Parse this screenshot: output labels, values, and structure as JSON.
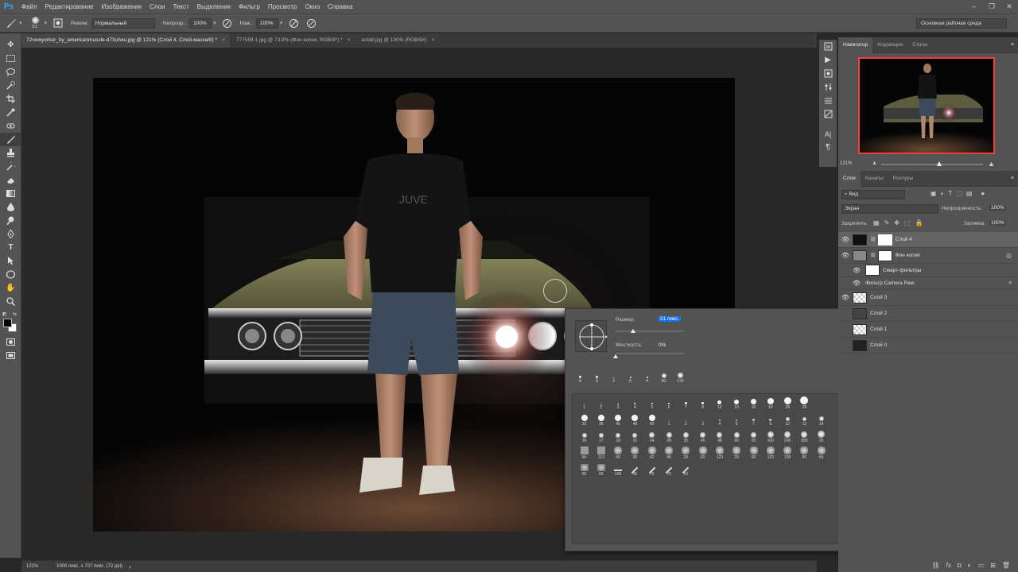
{
  "app": {
    "logo": "Ps"
  },
  "menu": [
    "Файл",
    "Редактирование",
    "Изображение",
    "Слои",
    "Текст",
    "Выделение",
    "Фильтр",
    "Просмотр",
    "Окно",
    "Справка"
  ],
  "window_controls": [
    "–",
    "❐",
    "✕"
  ],
  "options": {
    "brush_size": "51",
    "mode_label": "Режим:",
    "mode_value": "Нормальный",
    "opacity_label": "Непрозр.:",
    "opacity_value": "100%",
    "flow_label": "Наж.:",
    "flow_value": "100%",
    "workspace": "Основная рабочая среда"
  },
  "tabs": [
    {
      "label": "72newyorker_by_americanmuscle-d73uheu.jpg @ 121% (Слой 4, Слой-маска/8) *",
      "active": true
    },
    {
      "label": "777559-1.jpg @ 73,9% (Фон копия, RGB/8*) *",
      "active": false
    },
    {
      "label": "asfalt.jpg @ 100% (RGB/8#)",
      "active": false
    }
  ],
  "tab_close": "×",
  "status": {
    "zoom": "121%",
    "info": "1000 пикс. x 707 пикс. (72 ppi)",
    "arrow": "›"
  },
  "navigator": {
    "tabs": [
      "Навигатор",
      "Коррекция",
      "Стили"
    ],
    "zoom": "121%"
  },
  "layers_panel": {
    "tabs": [
      "Слои",
      "Каналы",
      "Контуры"
    ],
    "filter": "Вид",
    "blend_mode": "Экран",
    "opacity_label": "Непрозрачность:",
    "opacity_value": "100%",
    "lock_label": "Закрепить:",
    "fill_label": "Заливка:",
    "fill_value": "100%",
    "layers": [
      {
        "name": "Слой 4",
        "selected": true
      },
      {
        "name": "Фон копия",
        "selected": false
      },
      {
        "name": "Смарт-фильтры",
        "selected": false
      },
      {
        "name": "Фильтр Camera Raw",
        "selected": false
      },
      {
        "name": "Слой 3",
        "selected": false
      },
      {
        "name": "Слой 2",
        "selected": false
      },
      {
        "name": "Слой 1",
        "selected": false
      },
      {
        "name": "Слой 0",
        "selected": false
      }
    ]
  },
  "brush_picker": {
    "size_label": "Размер:",
    "size_value": "51 пикс.",
    "hardness_label": "Жесткость:",
    "hardness_value": "0%",
    "recent": [
      {
        "n": "8",
        "s": 3
      },
      {
        "n": "9",
        "s": 3
      },
      {
        "n": "3",
        "s": 1
      },
      {
        "n": "6",
        "s": 2
      },
      {
        "n": "4",
        "s": 2
      },
      {
        "n": "60",
        "s": 6
      },
      {
        "n": "175",
        "s": 7
      }
    ],
    "rows": [
      [
        {
          "n": "1",
          "s": 1
        },
        {
          "n": "2",
          "s": 1
        },
        {
          "n": "3",
          "s": 1.5
        },
        {
          "n": "4",
          "s": 2
        },
        {
          "n": "5",
          "s": 2
        },
        {
          "n": "6",
          "s": 2.5
        },
        {
          "n": "7",
          "s": 3
        },
        {
          "n": "8",
          "s": 3
        },
        {
          "n": "12",
          "s": 5
        },
        {
          "n": "13",
          "s": 6
        },
        {
          "n": "16",
          "s": 7
        },
        {
          "n": "19",
          "s": 8
        },
        {
          "n": "24",
          "s": 9
        },
        {
          "n": "28",
          "s": 10
        }
      ],
      [
        {
          "n": "32",
          "s": 8
        },
        {
          "n": "36",
          "s": 8
        },
        {
          "n": "45",
          "s": 8
        },
        {
          "n": "48",
          "s": 8
        },
        {
          "n": "60",
          "s": 8
        },
        {
          "n": "1",
          "s": 1
        },
        {
          "n": "2",
          "s": 1
        },
        {
          "n": "3",
          "s": 1.5
        },
        {
          "n": "4",
          "s": 2
        },
        {
          "n": "5",
          "s": 2
        },
        {
          "n": "7",
          "s": 3
        },
        {
          "n": "9",
          "s": 3
        },
        {
          "n": "12",
          "s": 5
        },
        {
          "n": "13",
          "s": 5
        },
        {
          "n": "14",
          "s": 6
        }
      ],
      [
        {
          "n": "16",
          "s": 6
        },
        {
          "n": "17",
          "s": 6
        },
        {
          "n": "18",
          "s": 6
        },
        {
          "n": "21",
          "s": 6
        },
        {
          "n": "24",
          "s": 7
        },
        {
          "n": "28",
          "s": 7
        },
        {
          "n": "35",
          "s": 7
        },
        {
          "n": "45",
          "s": 7
        },
        {
          "n": "48",
          "s": 7
        },
        {
          "n": "60",
          "s": 7
        },
        {
          "n": "65",
          "s": 7
        },
        {
          "n": "100",
          "s": 8
        },
        {
          "n": "200",
          "s": 8
        },
        {
          "n": "300",
          "s": 8
        },
        {
          "n": "25",
          "s": 9
        }
      ],
      [
        {
          "n": "60",
          "s": 9
        },
        {
          "n": "113",
          "s": 9
        },
        {
          "n": "50",
          "s": 9
        },
        {
          "n": "90",
          "s": 9
        },
        {
          "n": "40",
          "s": 9
        },
        {
          "n": "90",
          "s": 9
        },
        {
          "n": "20",
          "s": 9
        },
        {
          "n": "60",
          "s": 9
        },
        {
          "n": "120",
          "s": 9
        },
        {
          "n": "20",
          "s": 9
        },
        {
          "n": "60",
          "s": 9
        },
        {
          "n": "120",
          "s": 9
        },
        {
          "n": "130",
          "s": 9
        },
        {
          "n": "90",
          "s": 9
        },
        {
          "n": "65",
          "s": 9
        }
      ],
      [
        {
          "n": "65",
          "s": 9
        },
        {
          "n": "65",
          "s": 9
        },
        {
          "n": "100",
          "s": 4
        },
        {
          "n": "95",
          "s": 4
        },
        {
          "n": "75",
          "s": 4
        },
        {
          "n": "75",
          "s": 4
        },
        {
          "n": "50",
          "s": 4
        }
      ]
    ]
  },
  "colors": {
    "ui_dark": "#282828",
    "ui_panel": "#535353",
    "selection": "#1473e6",
    "nav_box": "#ff3b3b"
  }
}
